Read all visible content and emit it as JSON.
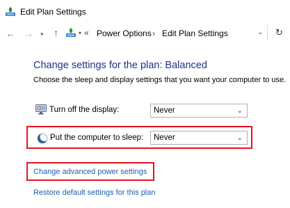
{
  "window": {
    "title": "Edit Plan Settings",
    "icon": "power-options-icon"
  },
  "nav": {
    "back_glyph": "←",
    "forward_glyph": "→",
    "recent_glyph": "▾",
    "up_glyph": "↑",
    "breadcrumb_overflow": "«",
    "breadcrumbs": [
      "Power Options",
      "Edit Plan Settings"
    ],
    "separator": "›",
    "dropdown_glyph": "⌄",
    "refresh_glyph": "↻"
  },
  "main": {
    "heading": "Change settings for the plan: Balanced",
    "subheading": "Choose the sleep and display settings that you want your computer to use.",
    "settings": [
      {
        "label": "Turn off the display:",
        "value": "Never",
        "icon": "display-icon"
      },
      {
        "label": "Put the computer to sleep:",
        "value": "Never",
        "icon": "sleep-moon-icon",
        "highlighted": true
      }
    ],
    "links": {
      "advanced": "Change advanced power settings",
      "restore": "Restore default settings for this plan"
    }
  },
  "colors": {
    "heading": "#1e3287",
    "link": "#1a5fb4",
    "highlight": "#e81123"
  }
}
